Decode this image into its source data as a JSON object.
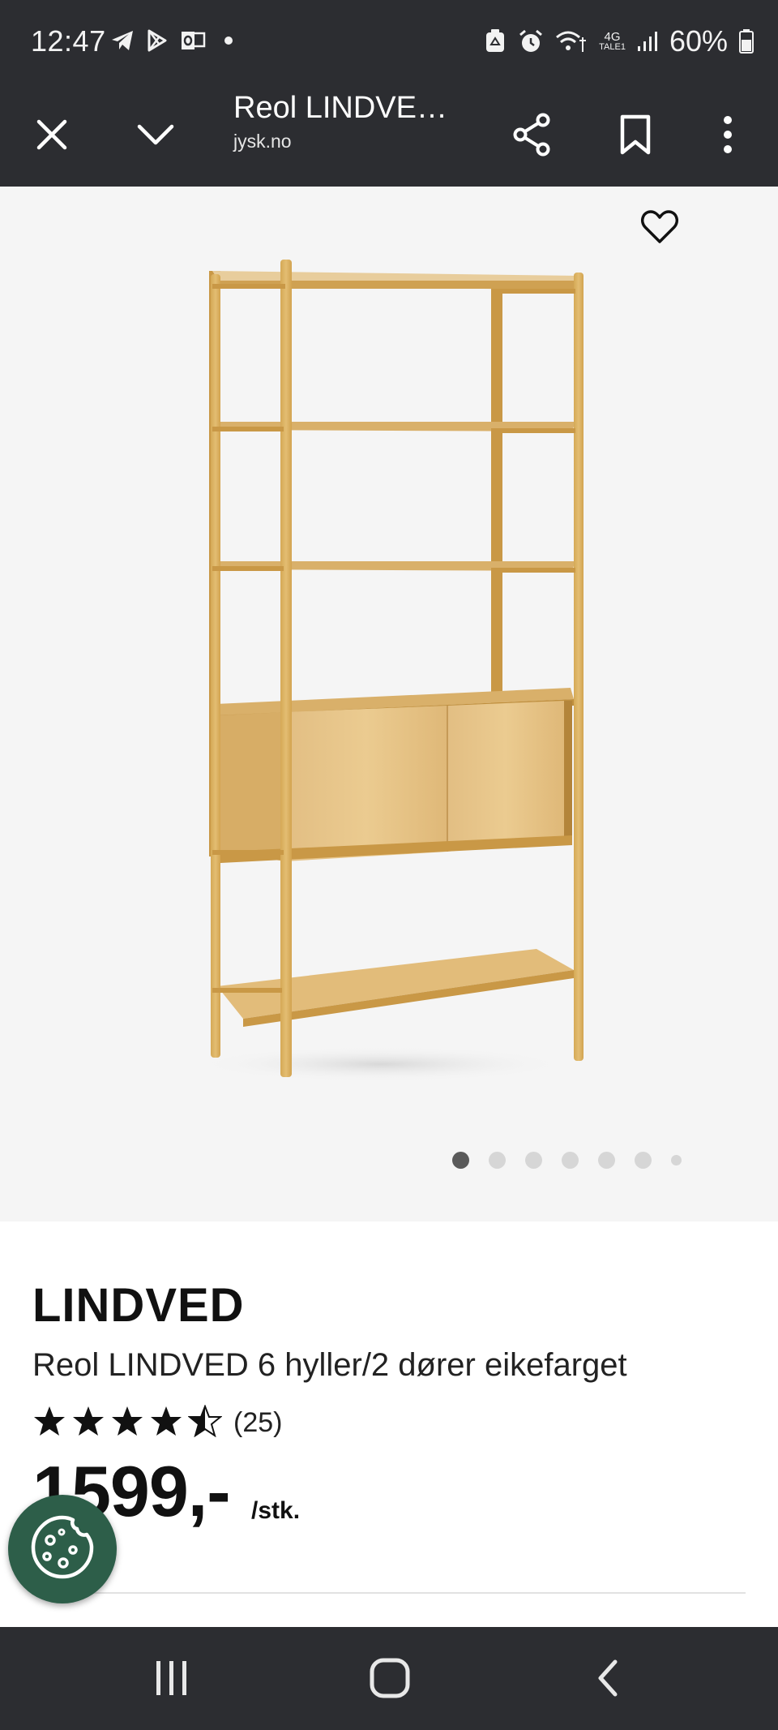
{
  "status_bar": {
    "time": "12:47",
    "battery": "60%",
    "network_label_top": "4G",
    "network_label_bottom": "TALE1",
    "left_icons": [
      "telegram-icon",
      "play-store-icon",
      "outlook-icon",
      "dot-icon"
    ],
    "right_icons": [
      "recycle-icon",
      "alarm-icon",
      "wifi-calling-icon",
      "signal-icon",
      "battery-icon"
    ]
  },
  "toolbar": {
    "title": "Reol LINDVE…",
    "domain": "jysk.no",
    "icons": [
      "close-icon",
      "chevron-down-icon",
      "share-icon",
      "bookmark-icon",
      "more-vert-icon"
    ]
  },
  "gallery": {
    "image_count": 7,
    "active_index": 0,
    "favorite_icon": "heart-icon"
  },
  "product": {
    "brand": "LINDVED",
    "name": "Reol LINDVED 6 hyller/2 dører eikefarget",
    "rating": 4.5,
    "rating_max": 5,
    "review_count": "(25)",
    "price": "1599,-",
    "unit": "/stk."
  },
  "colors": {
    "bar_bg": "#2c2d31",
    "gallery_bg": "#f5f5f5",
    "cookie_bg": "#2d5e49",
    "wood": "#d4a24e"
  },
  "nav_bar": {
    "icons": [
      "recent-apps-icon",
      "home-icon",
      "back-icon"
    ]
  }
}
